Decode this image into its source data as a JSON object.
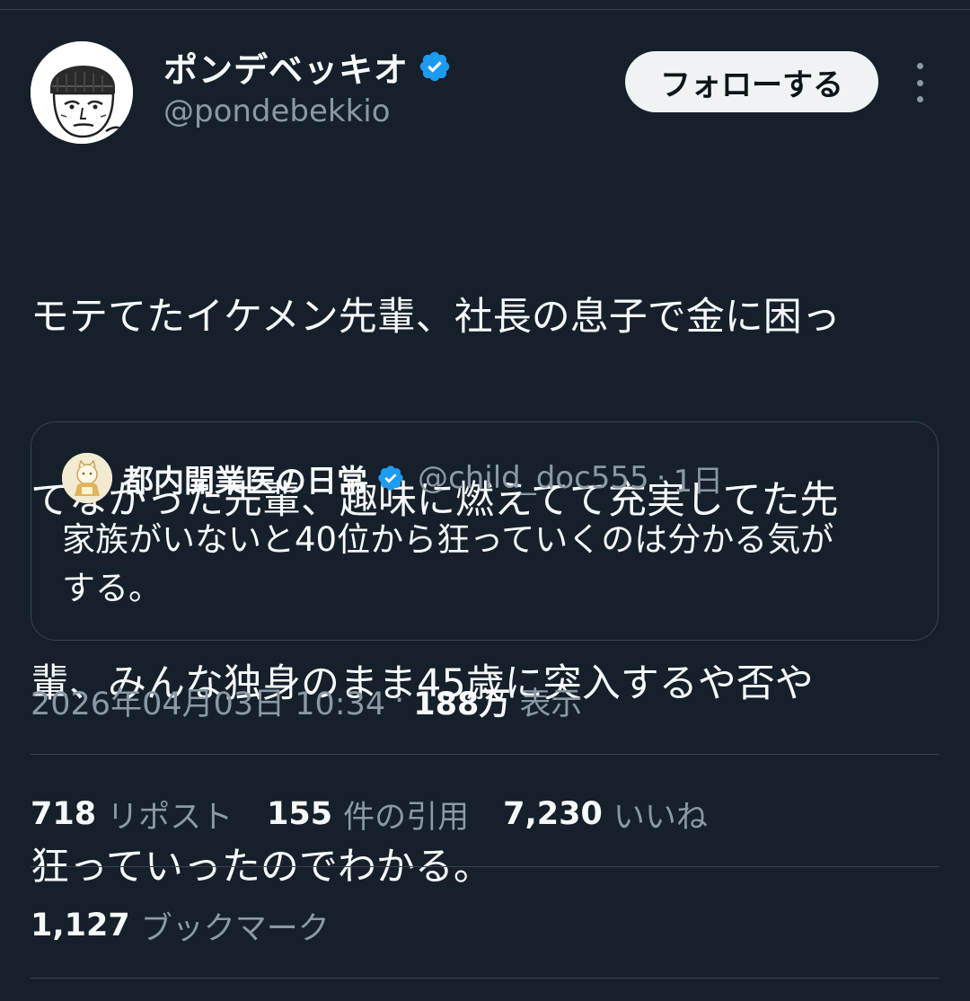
{
  "author": {
    "display_name": "ポンデベッキオ",
    "handle": "@pondebekkio",
    "verified": true
  },
  "actions": {
    "follow_label": "フォローする"
  },
  "tweet": {
    "text_lines": [
      "モテてたイケメン先輩、社長の息子で金に困っ",
      "てなかった先輩、趣味に燃えてて充実してた先",
      "輩、みんな独身のまま45歳に突入するや否や",
      "狂っていったのでわかる。"
    ]
  },
  "quote": {
    "display_name": "都内開業医の日常",
    "handle": "@child_doc555",
    "separator": "·",
    "time": "1日",
    "verified": true,
    "text_lines": [
      "家族がいないと40位から狂っていくのは分かる気が",
      "する。"
    ]
  },
  "meta": {
    "datetime": "2026年04月03日 10:34",
    "separator": "·",
    "views_count": "188万",
    "views_label": "表示"
  },
  "stats": {
    "reposts": {
      "count": "718",
      "label": "リポスト"
    },
    "quotes": {
      "count": "155",
      "label": "件の引用"
    },
    "likes": {
      "count": "7,230",
      "label": "いいね"
    },
    "bookmarks": {
      "count": "1,127",
      "label": "ブックマーク"
    }
  },
  "colors": {
    "background": "#15202b",
    "text_primary": "#f7f9f9",
    "text_secondary": "#8b98a5",
    "border": "#38444d",
    "verified_badge": "#1d9bf0",
    "follow_button_bg": "#eff3f4"
  }
}
